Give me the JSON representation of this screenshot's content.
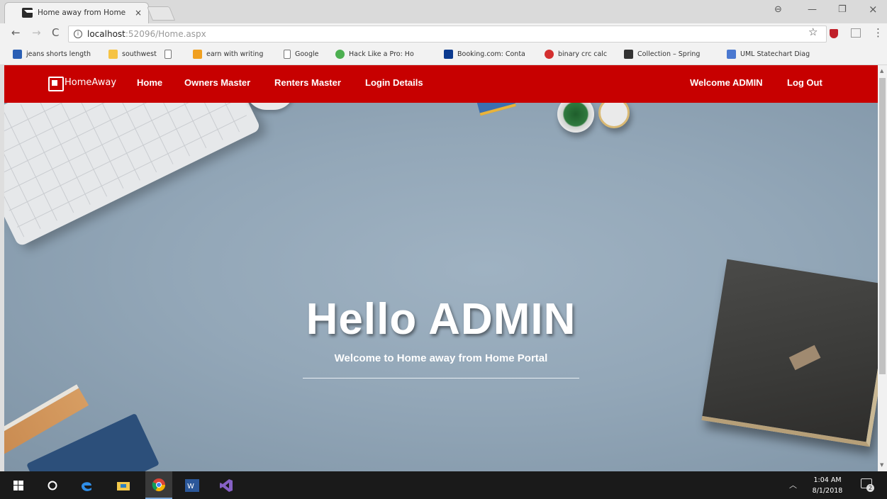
{
  "browser": {
    "tab_title": "Home away from Home",
    "tab_close": "×",
    "url_host": "localhost",
    "url_rest": ":52096/Home.aspx",
    "window_controls": {
      "account": "⊖",
      "minimize": "—",
      "restore": "❐",
      "close": "×"
    }
  },
  "bookmarks": [
    {
      "label": "jeans shorts length",
      "icon_color": "#2b5fb4"
    },
    {
      "label": "southwest",
      "icon_color": "#f6c343"
    },
    {
      "label": "",
      "icon_color": "#ffffff"
    },
    {
      "label": "earn with writing",
      "icon_color": "#f0a020"
    },
    {
      "label": "Google",
      "icon_color": "#ffffff"
    },
    {
      "label": "Hack Like a Pro: Ho",
      "icon_color": "#4caf50"
    },
    {
      "label": "Booking.com: Conta",
      "icon_color": "#0b3a8f"
    },
    {
      "label": "binary crc calc",
      "icon_color": "#d32f2f"
    },
    {
      "label": "Collection – Spring",
      "icon_color": "#333333"
    },
    {
      "label": "UML Statechart Diag",
      "icon_color": "#4a78d0"
    }
  ],
  "site_nav": {
    "brand": "HomeAway",
    "links": [
      "Home",
      "Owners Master",
      "Renters Master",
      "Login Details"
    ],
    "welcome": "Welcome ADMIN",
    "logout": "Log Out"
  },
  "hero": {
    "title": "Hello ADMIN",
    "subtitle": "Welcome to Home away from Home Portal"
  },
  "taskbar": {
    "time": "1:04 AM",
    "date": "8/1/2018",
    "notifications": "2"
  },
  "colors": {
    "nav_bg": "#c70000",
    "hero_bg": "#93a7b8"
  }
}
